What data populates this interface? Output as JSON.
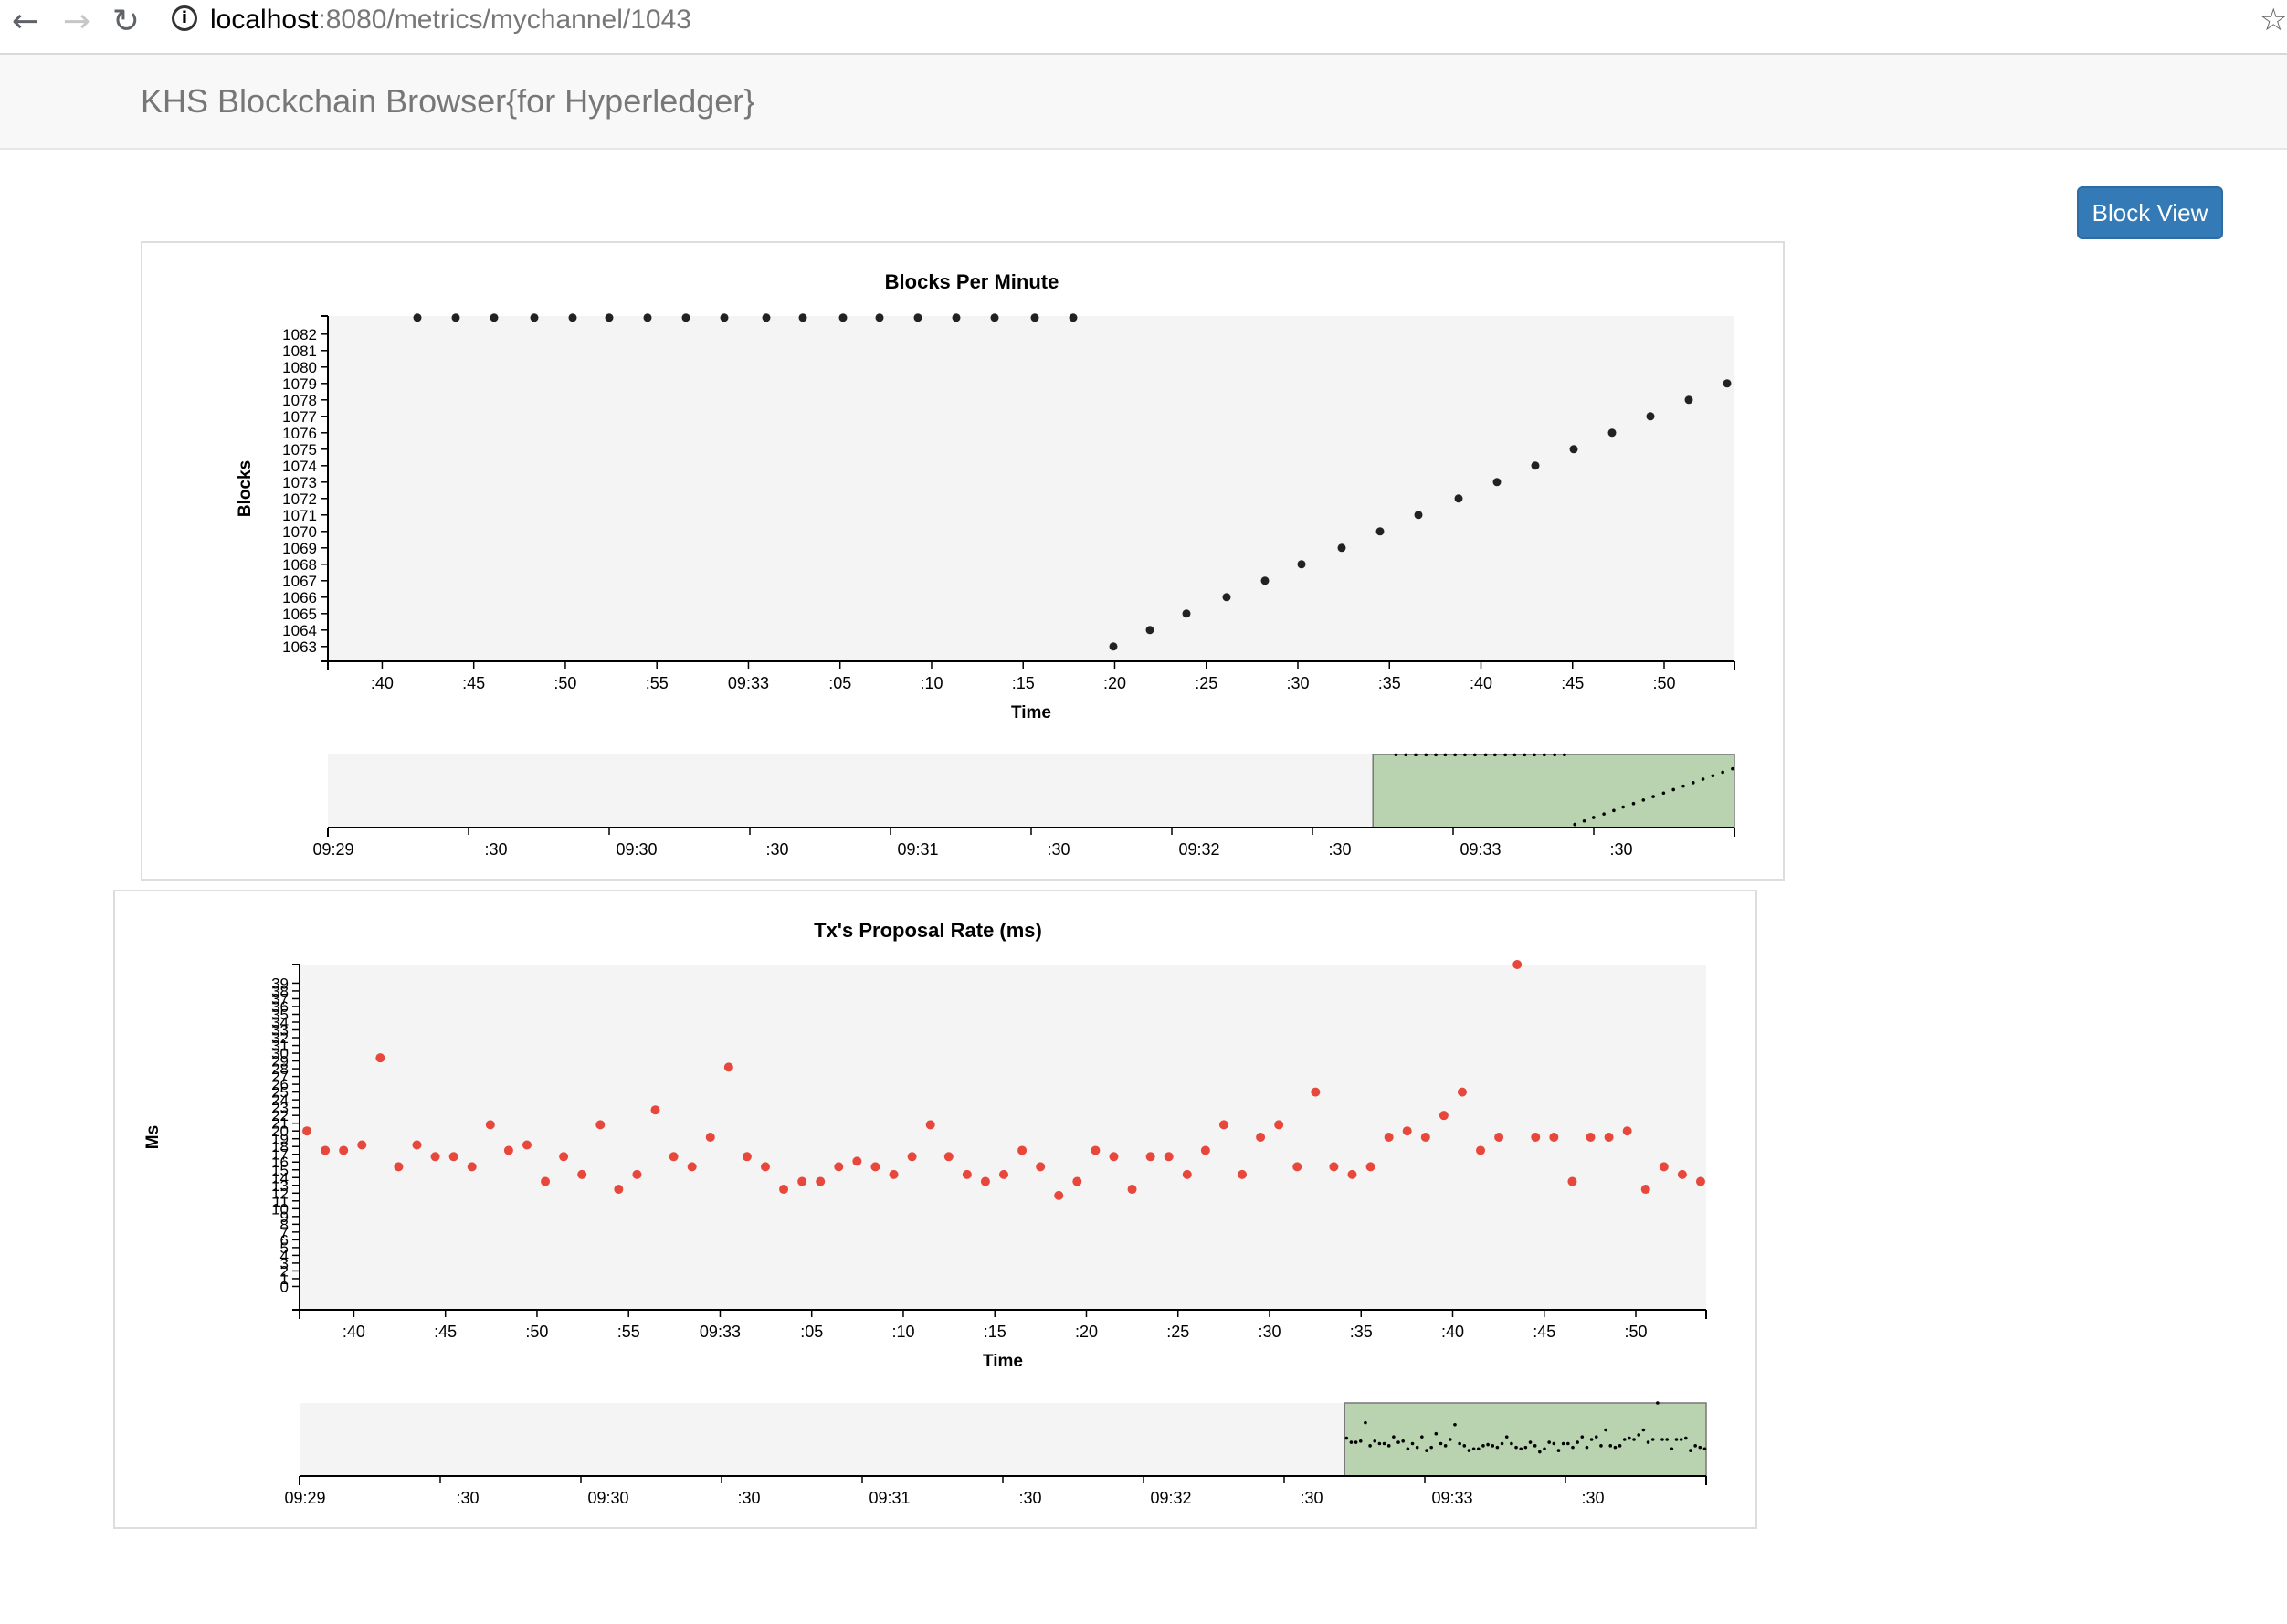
{
  "browser": {
    "url_host": "localhost",
    "url_rest": ":8080/metrics/mychannel/1043"
  },
  "brand": "KHS Blockchain Browser{for Hyperledger}",
  "block_view_label": "Block View",
  "colors": {
    "plot_bg": "#f4f4f4",
    "blocks_dot": "#222222",
    "tx_dot": "#e8473c",
    "brush_fill": "#b9d3b0",
    "button": "#337ab7"
  },
  "chart_data": [
    {
      "type": "scatter",
      "title": "Blocks Per Minute",
      "xlabel": "Time",
      "ylabel": "Blocks",
      "x_ticks": [
        ":40",
        ":45",
        ":50",
        ":55",
        "09:33",
        ":05",
        ":10",
        ":15",
        ":20",
        ":25",
        ":30",
        ":35",
        ":40",
        ":45",
        ":50"
      ],
      "y_ticks": [
        1063,
        1064,
        1065,
        1066,
        1067,
        1068,
        1069,
        1070,
        1071,
        1072,
        1073,
        1074,
        1075,
        1076,
        1077,
        1078,
        1079,
        1080,
        1081,
        1082
      ],
      "xlim": [
        36,
        113
      ],
      "ylim": [
        1062.1,
        1083.1
      ],
      "series": [
        {
          "x": [
            40.9,
            43,
            45.1,
            47.3,
            49.4,
            51.4,
            53.5,
            55.6,
            57.7,
            60,
            62,
            64.2,
            66.2,
            68.3,
            70.4,
            72.5,
            74.7,
            76.8,
            79,
            81,
            83,
            85.2,
            87.3,
            89.3,
            91.5,
            93.6,
            95.7,
            97.9,
            100,
            102.1,
            104.2,
            106.3,
            108.4,
            110.5,
            112.6
          ],
          "y": [
            1083,
            1083,
            1083,
            1083,
            1083,
            1083,
            1083,
            1083,
            1083,
            1083,
            1083,
            1083,
            1083,
            1083,
            1083,
            1083,
            1083,
            1083,
            1063,
            1064,
            1065,
            1066,
            1067,
            1068,
            1069,
            1070,
            1071,
            1072,
            1073,
            1074,
            1075,
            1076,
            1077,
            1078,
            1079
          ]
        }
      ],
      "overview": {
        "x_ticks": [
          "09:29",
          ":30",
          "09:30",
          ":30",
          "09:31",
          ":30",
          "09:32",
          ":30",
          "09:33",
          ":30"
        ],
        "brush_range": [
          0.743,
          1.0
        ]
      }
    },
    {
      "type": "scatter",
      "title": "Tx's Proposal Rate (ms)",
      "xlabel": "Time",
      "ylabel": "Ms",
      "x_ticks": [
        ":40",
        ":45",
        ":50",
        ":55",
        "09:33",
        ":05",
        ":10",
        ":15",
        ":20",
        ":25",
        ":30",
        ":35",
        ":40",
        ":45",
        ":50"
      ],
      "y_ticks": [
        0,
        1,
        2,
        3,
        4,
        5,
        6,
        7,
        8,
        9,
        10,
        11,
        12,
        13,
        14,
        15,
        16,
        17,
        18,
        19,
        20,
        21,
        22,
        23,
        24,
        25,
        26,
        27,
        28,
        29,
        30,
        31,
        32,
        33,
        34,
        35,
        36,
        37,
        38,
        39
      ],
      "xlim": [
        36.6,
        113.3
      ],
      "ylim": [
        -3,
        41.4
      ],
      "series": [
        {
          "x": [
            37,
            38,
            39,
            40,
            41,
            42,
            43,
            44,
            45,
            46,
            47,
            48,
            49,
            50,
            51,
            52,
            53,
            54,
            55,
            56,
            57,
            58,
            59,
            60,
            61,
            62,
            63,
            64,
            65,
            66,
            67,
            68,
            69,
            70,
            71,
            72,
            73,
            74,
            75,
            76,
            77,
            78,
            79,
            80,
            81,
            82,
            83,
            84,
            85,
            86,
            87,
            88,
            89,
            90,
            91,
            92,
            93,
            94,
            95,
            96,
            97,
            98,
            99,
            100,
            101,
            102,
            103,
            104,
            105,
            106,
            107,
            108,
            109,
            110,
            111,
            112,
            113
          ],
          "y": [
            20,
            17.5,
            17.5,
            18.2,
            29.4,
            15.4,
            18.2,
            16.7,
            16.7,
            15.4,
            20.8,
            17.5,
            18.2,
            13.5,
            16.7,
            14.4,
            20.8,
            12.5,
            14.4,
            22.7,
            16.7,
            15.4,
            19.2,
            28.2,
            16.7,
            15.4,
            12.5,
            13.5,
            13.5,
            15.4,
            16.1,
            15.4,
            14.4,
            16.7,
            20.8,
            16.7,
            14.4,
            13.5,
            14.4,
            17.5,
            15.4,
            11.7,
            13.5,
            17.5,
            16.7,
            12.5,
            16.7,
            16.7,
            14.4,
            17.5,
            20.8,
            14.4,
            19.2,
            20.8,
            15.4,
            25,
            15.4,
            14.4,
            15.4,
            19.2,
            20,
            19.2,
            22,
            25,
            17.5,
            19.2,
            41.4,
            19.2,
            19.2,
            13.5,
            19.2,
            19.2,
            20,
            12.5,
            15.4,
            14.4,
            13.5
          ]
        }
      ],
      "overview": {
        "x_ticks": [
          "09:29",
          ":30",
          "09:30",
          ":30",
          "09:31",
          ":30",
          "09:32",
          ":30",
          "09:33",
          ":30"
        ],
        "brush_range": [
          0.743,
          1.0
        ]
      }
    }
  ]
}
